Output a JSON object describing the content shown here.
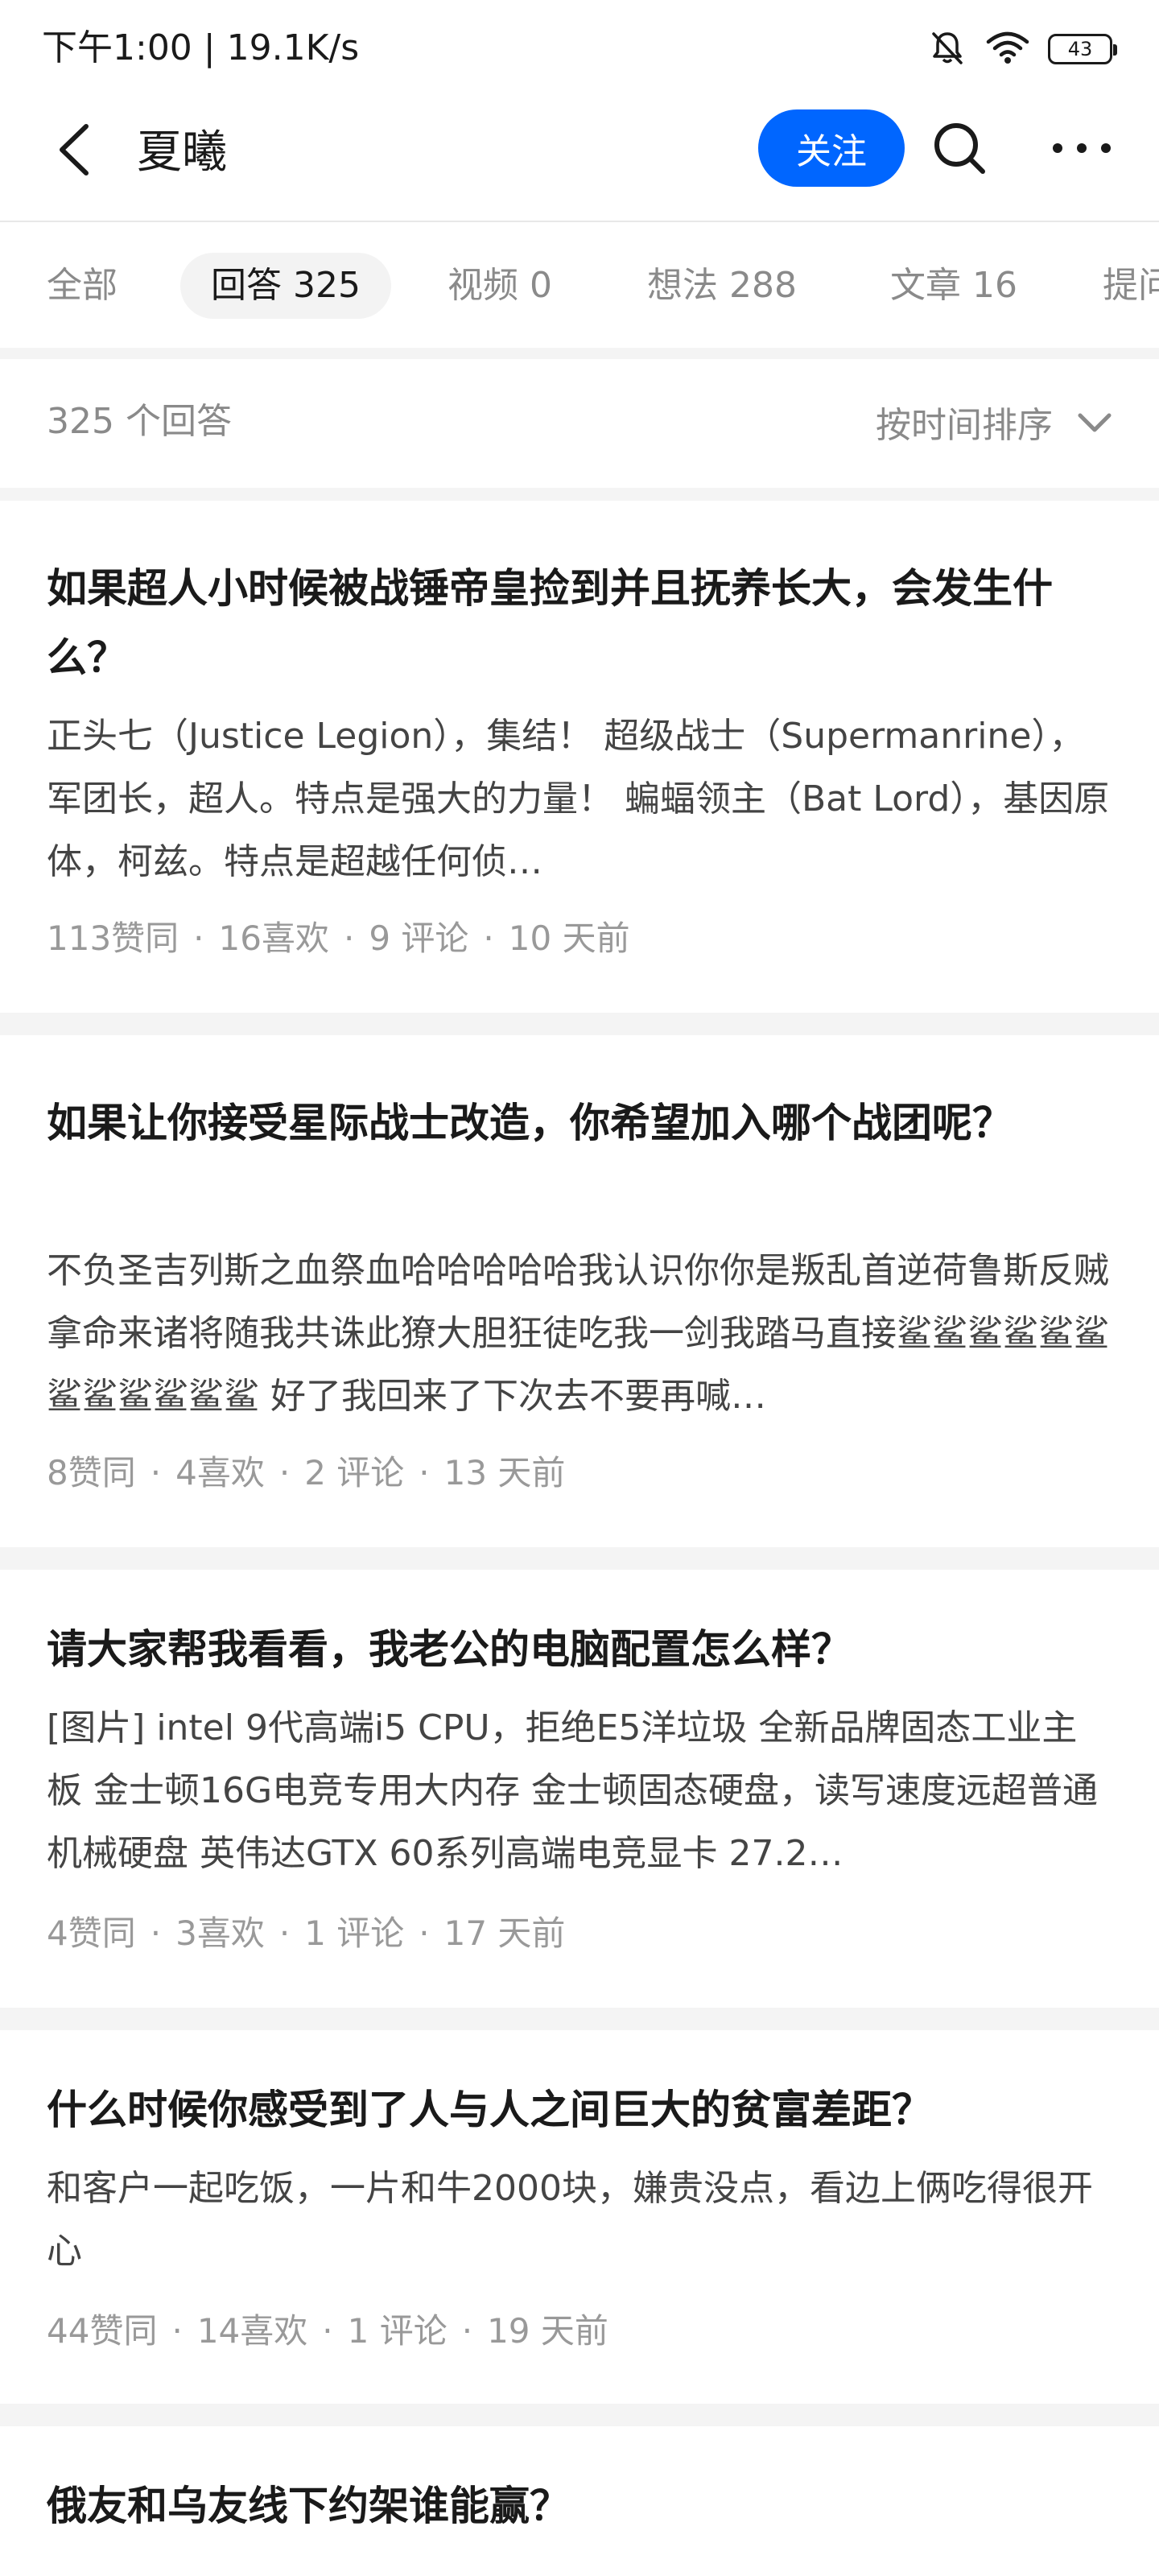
{
  "status_bar": {
    "time": "下午1:00 | 19.1K/s",
    "battery": "43",
    "icons": [
      "bell-off-icon",
      "wifi-icon",
      "battery-icon"
    ]
  },
  "header": {
    "title": "夏曦",
    "follow_label": "关注",
    "icons": [
      "back-arrow-icon",
      "search-icon",
      "more-icon"
    ],
    "accent_color": "#0066ff"
  },
  "tabs": [
    {
      "label": "全部"
    },
    {
      "label": "回答 325",
      "active": true
    },
    {
      "label": "视频 0"
    },
    {
      "label": "想法 288"
    },
    {
      "label": "文章 16"
    },
    {
      "label": "提问"
    }
  ],
  "list_header": {
    "count_label": "325 个回答",
    "sort_label": "按时间排序"
  },
  "answers": [
    {
      "title": "如果超人小时候被战锤帝皇捡到并且抚养长大，会发生什么？",
      "excerpt": "正头七（Justice Legion），集结！ 超级战士（Supermanrine），军团长，超人。特点是强大的力量！ 蝙蝠领主（Bat Lord），基因原体，柯兹。特点是超越任何侦…",
      "upvotes": "113赞同",
      "likes": "16喜欢",
      "comments": "9 评论",
      "time": "10 天前"
    },
    {
      "title": "如果让你接受星际战士改造，你希望加入哪个战团呢？",
      "excerpt": "不负圣吉列斯之血祭血哈哈哈哈哈我认识你你是叛乱首逆荷鲁斯反贼拿命来诸将随我共诛此獠大胆狂徒吃我一剑我踏马直接鲨鲨鲨鲨鲨鲨鲨鲨鲨鲨鲨鲨 好了我回来了下次去不要再喊…",
      "upvotes": "8赞同",
      "likes": "4喜欢",
      "comments": "2 评论",
      "time": "13 天前"
    },
    {
      "title": "请大家帮我看看，我老公的电脑配置怎么样？",
      "excerpt": "[图片] intel 9代高端i5 CPU，拒绝E5洋垃圾 全新品牌固态工业主板 金士顿16G电竞专用大内存 金士顿固态硬盘，读写速度远超普通机械硬盘 英伟达GTX 60系列高端电竞显卡 27.2…",
      "upvotes": "4赞同",
      "likes": "3喜欢",
      "comments": "1 评论",
      "time": "17 天前"
    },
    {
      "title": "什么时候你感受到了人与人之间巨大的贫富差距？",
      "excerpt": "和客户一起吃饭，一片和牛2000块，嫌贵没点，看边上俩吃得很开心",
      "upvotes": "44赞同",
      "likes": "14喜欢",
      "comments": "1 评论",
      "time": "19 天前"
    },
    {
      "title": "俄友和乌友线下约架谁能赢？"
    }
  ]
}
